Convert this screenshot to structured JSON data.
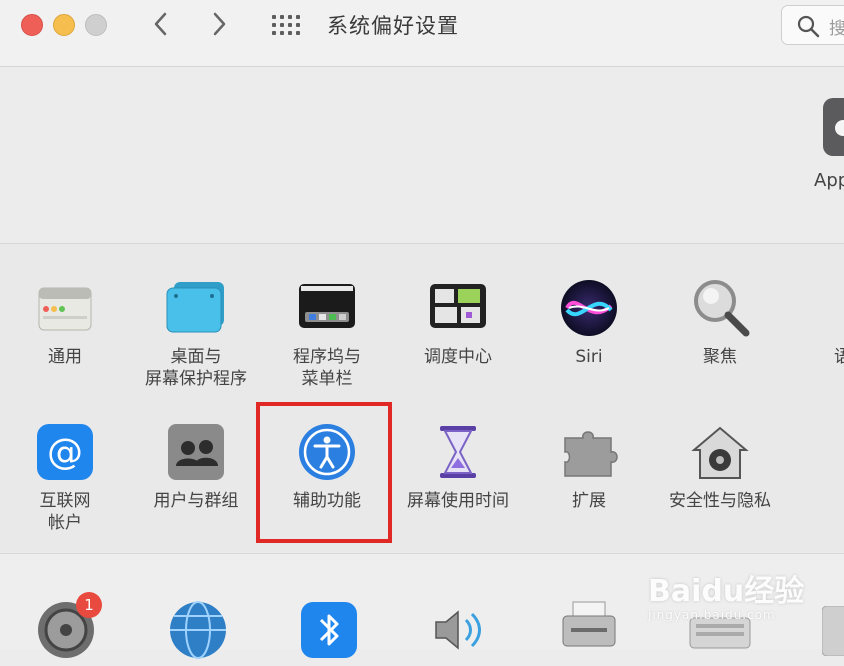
{
  "window": {
    "title": "系统偏好设置",
    "search_placeholder": "搜"
  },
  "account": {
    "apple_id_label": "App"
  },
  "row1": [
    {
      "label": "通用",
      "icon": "general-icon"
    },
    {
      "label": "桌面与\n屏幕保护程序",
      "icon": "desktop-icon"
    },
    {
      "label": "程序坞与\n菜单栏",
      "icon": "dock-icon"
    },
    {
      "label": "调度中心",
      "icon": "mission-control-icon"
    },
    {
      "label": "Siri",
      "icon": "siri-icon"
    },
    {
      "label": "聚焦",
      "icon": "spotlight-icon"
    },
    {
      "label": "语言",
      "icon": "language-icon"
    }
  ],
  "row2": [
    {
      "label": "互联网\n帐户",
      "icon": "internet-accounts-icon"
    },
    {
      "label": "用户与群组",
      "icon": "users-icon"
    },
    {
      "label": "辅助功能",
      "icon": "accessibility-icon"
    },
    {
      "label": "屏幕使用时间",
      "icon": "screen-time-icon"
    },
    {
      "label": "扩展",
      "icon": "extensions-icon"
    },
    {
      "label": "安全性与隐私",
      "icon": "security-icon"
    }
  ],
  "row3": {
    "software_update_badge": "1"
  },
  "watermark": {
    "big": "Baidu经验",
    "small": "jingyan.baidu.com"
  },
  "colors": {
    "highlight": "#e02824",
    "close": "#ed5f57",
    "minimize": "#f5be4f",
    "zoom": "#cfcfcf"
  }
}
